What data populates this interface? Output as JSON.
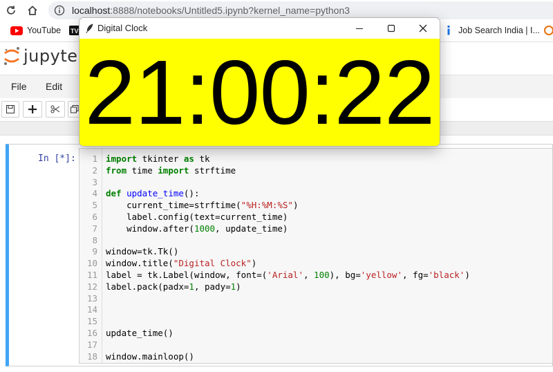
{
  "browser": {
    "url_host": "localhost",
    "url_rest": ":8888/notebooks/Untitled5.ipynb?kernel_name=python3",
    "bookmarks": [
      {
        "label": "YouTube",
        "icon": "youtube-icon"
      },
      {
        "label": "Job Search India | I...",
        "icon": "info-icon"
      }
    ]
  },
  "jupyter": {
    "logo_text": "jupyter",
    "menu": [
      "File",
      "Edit"
    ],
    "cell_prompt": "In [*]:",
    "code_lines": [
      [
        {
          "t": "import",
          "c": "kw"
        },
        {
          "t": " tkinter "
        },
        {
          "t": "as",
          "c": "kw"
        },
        {
          "t": " tk"
        }
      ],
      [
        {
          "t": "from",
          "c": "kw"
        },
        {
          "t": " time "
        },
        {
          "t": "import",
          "c": "kw"
        },
        {
          "t": " strftime"
        }
      ],
      [],
      [
        {
          "t": "def",
          "c": "kw"
        },
        {
          "t": " "
        },
        {
          "t": "update_time",
          "c": "df"
        },
        {
          "t": "():"
        }
      ],
      [
        {
          "t": "    current_time=strftime("
        },
        {
          "t": "\"%H:%M:%S\"",
          "c": "st"
        },
        {
          "t": ")"
        }
      ],
      [
        {
          "t": "    label.config(text=current_time)"
        }
      ],
      [
        {
          "t": "    window.after("
        },
        {
          "t": "1000",
          "c": "nm"
        },
        {
          "t": ", update_time)"
        }
      ],
      [],
      [
        {
          "t": "window=tk.Tk()"
        }
      ],
      [
        {
          "t": "window.title("
        },
        {
          "t": "\"Digital Clock\"",
          "c": "st"
        },
        {
          "t": ")"
        }
      ],
      [
        {
          "t": "label = tk.Label(window, font=("
        },
        {
          "t": "'Arial'",
          "c": "st"
        },
        {
          "t": ", "
        },
        {
          "t": "100",
          "c": "nm"
        },
        {
          "t": "), bg="
        },
        {
          "t": "'yellow'",
          "c": "st"
        },
        {
          "t": ", fg="
        },
        {
          "t": "'black'",
          "c": "st"
        },
        {
          "t": ")"
        }
      ],
      [
        {
          "t": "label.pack(padx="
        },
        {
          "t": "1",
          "c": "nm"
        },
        {
          "t": ", pady="
        },
        {
          "t": "1",
          "c": "nm"
        },
        {
          "t": ")"
        }
      ],
      [],
      [],
      [],
      [
        {
          "t": "update_time()"
        }
      ],
      [],
      [
        {
          "t": "window.mainloop()"
        }
      ]
    ]
  },
  "tk_window": {
    "title": "Digital Clock",
    "time": "21:00:22",
    "bg_color": "#ffff00",
    "fg_color": "#000000"
  }
}
